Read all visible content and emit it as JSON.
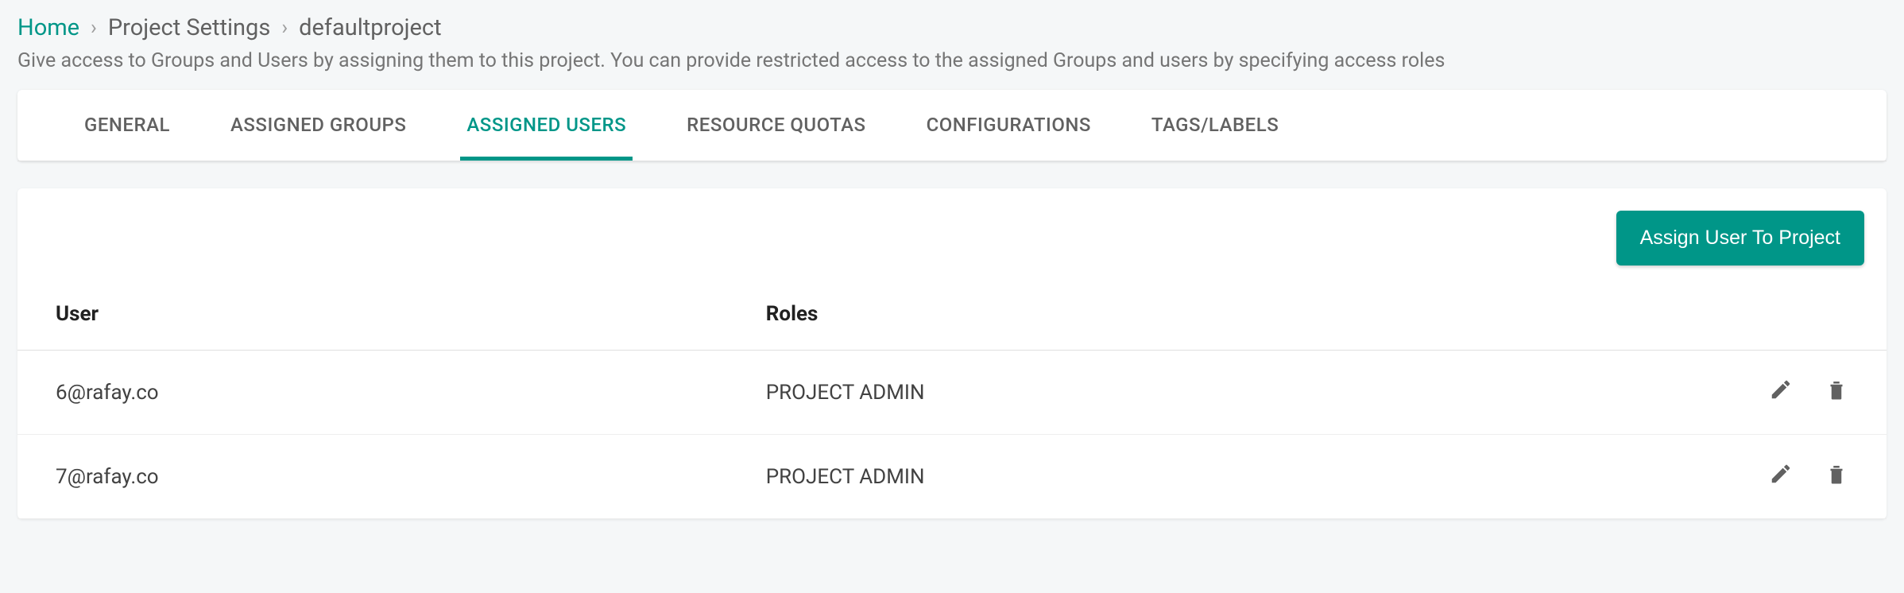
{
  "breadcrumb": {
    "home": "Home",
    "section": "Project Settings",
    "current": "defaultproject"
  },
  "description": "Give access to Groups and Users by assigning them to this project. You can provide restricted access to the assigned Groups and users by specifying access roles",
  "tabs": {
    "general": "GENERAL",
    "assigned_groups": "ASSIGNED GROUPS",
    "assigned_users": "ASSIGNED USERS",
    "resource_quotas": "RESOURCE QUOTAS",
    "configurations": "CONFIGURATIONS",
    "tags_labels": "TAGS/LABELS",
    "active": "assigned_users"
  },
  "actions": {
    "assign_user": "Assign User To Project"
  },
  "table": {
    "headers": {
      "user": "User",
      "roles": "Roles"
    },
    "rows": [
      {
        "user": "6@rafay.co",
        "roles": "PROJECT ADMIN"
      },
      {
        "user": "7@rafay.co",
        "roles": "PROJECT ADMIN"
      }
    ]
  },
  "colors": {
    "accent": "#009688"
  }
}
